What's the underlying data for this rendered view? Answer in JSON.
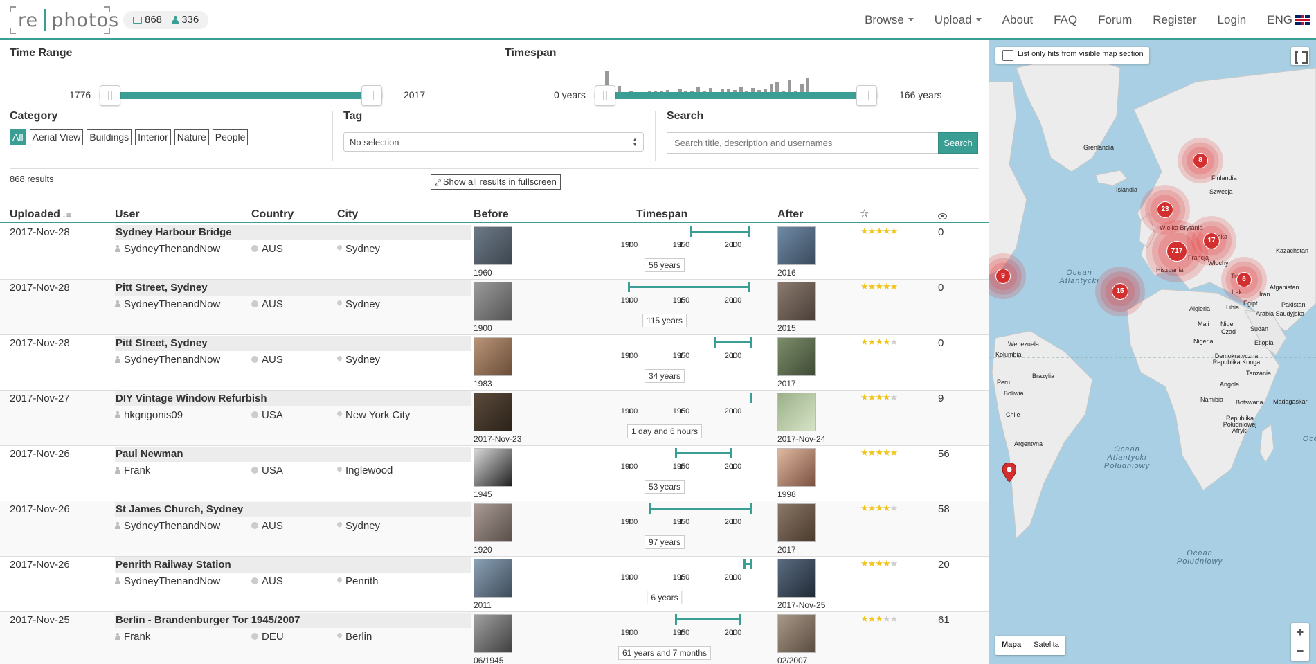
{
  "header": {
    "photo_count": "868",
    "user_count": "336",
    "nav": {
      "browse": "Browse",
      "upload": "Upload",
      "about": "About",
      "faq": "FAQ",
      "forum": "Forum",
      "register": "Register",
      "login": "Login",
      "language": "ENG"
    }
  },
  "filters": {
    "time_range_title": "Time Range",
    "time_range_min": "1776",
    "time_range_max": "2017",
    "timespan_title": "Timespan",
    "timespan_min": "0 years",
    "timespan_max": "166 years",
    "category_title": "Category",
    "categories": [
      "All",
      "Aerial View",
      "Buildings",
      "Interior",
      "Nature",
      "People"
    ],
    "active_category": "All",
    "tag_title": "Tag",
    "tag_value": "No selection",
    "search_title": "Search",
    "search_placeholder": "Search title, description and usernames",
    "search_button": "Search"
  },
  "results": {
    "count_text": "868 results",
    "fullscreen_label": "Show all results in fullscreen"
  },
  "table": {
    "headers": {
      "uploaded": "Uploaded",
      "user": "User",
      "country": "Country",
      "city": "City",
      "before": "Before",
      "timespan": "Timespan",
      "after": "After",
      "rating_icon": "star-icon",
      "views_icon": "eye-icon"
    },
    "timeline_ticks": [
      "1900",
      "1950",
      "2000"
    ],
    "rows": [
      {
        "uploaded": "2017-Nov-28",
        "title": "Sydney Harbour Bridge",
        "user": "SydneyThenandNow",
        "country": "AUS",
        "city": "Sydney",
        "before_date": "1960",
        "after_date": "2016",
        "before_year": 1960,
        "after_year": 2016,
        "span": "56 years",
        "rating": 5,
        "views": "0"
      },
      {
        "uploaded": "2017-Nov-28",
        "title": "Pitt Street, Sydney",
        "user": "SydneyThenandNow",
        "country": "AUS",
        "city": "Sydney",
        "before_date": "1900",
        "after_date": "2015",
        "before_year": 1900,
        "after_year": 2015,
        "span": "115 years",
        "rating": 5,
        "views": "0"
      },
      {
        "uploaded": "2017-Nov-28",
        "title": "Pitt Street, Sydney",
        "user": "SydneyThenandNow",
        "country": "AUS",
        "city": "Sydney",
        "before_date": "1983",
        "after_date": "2017",
        "before_year": 1983,
        "after_year": 2017,
        "span": "34 years",
        "rating": 4,
        "views": "0"
      },
      {
        "uploaded": "2017-Nov-27",
        "title": "DIY Vintage Window Refurbish",
        "user": "hkgrigonis09",
        "country": "USA",
        "city": "New York City",
        "before_date": "2017-Nov-23",
        "after_date": "2017-Nov-24",
        "before_year": 2017,
        "after_year": 2017,
        "span": "1 day and 6 hours",
        "rating": 4,
        "views": "9"
      },
      {
        "uploaded": "2017-Nov-26",
        "title": "Paul Newman",
        "user": "Frank",
        "country": "USA",
        "city": "Inglewood",
        "before_date": "1945",
        "after_date": "1998",
        "before_year": 1945,
        "after_year": 1998,
        "span": "53 years",
        "rating": 5,
        "views": "56"
      },
      {
        "uploaded": "2017-Nov-26",
        "title": "St James Church, Sydney",
        "user": "SydneyThenandNow",
        "country": "AUS",
        "city": "Sydney",
        "before_date": "1920",
        "after_date": "2017",
        "before_year": 1920,
        "after_year": 2017,
        "span": "97 years",
        "rating": 4,
        "views": "58"
      },
      {
        "uploaded": "2017-Nov-26",
        "title": "Penrith Railway Station",
        "user": "SydneyThenandNow",
        "country": "AUS",
        "city": "Penrith",
        "before_date": "2011",
        "after_date": "2017-Nov-25",
        "before_year": 2011,
        "after_year": 2017,
        "span": "6 years",
        "rating": 4,
        "views": "20"
      },
      {
        "uploaded": "2017-Nov-25",
        "title": "Berlin - Brandenburger Tor 1945/2007",
        "user": "Frank",
        "country": "DEU",
        "city": "Berlin",
        "before_date": "06/1945",
        "after_date": "02/2007",
        "before_year": 1945,
        "after_year": 2007,
        "span": "61 years and 7 months",
        "rating": 3,
        "views": "61"
      }
    ]
  },
  "map": {
    "visible_toggle_label": "List only hits from visible map section",
    "type_map": "Mapa",
    "type_satellite": "Satelita",
    "zoom_in": "+",
    "zoom_out": "−",
    "clusters": [
      "8",
      "23",
      "717",
      "17",
      "6",
      "9",
      "15"
    ],
    "labels": [
      "Grenlandia",
      "Finlandia",
      "Szwecja",
      "Islandia",
      "Wielka Brytania",
      "Polska",
      "Francja",
      "Włochy",
      "Hiszpania",
      "Kazachstan",
      "Turcja",
      "Irak",
      "Iran",
      "Afganistan",
      "Pakistan",
      "Egipt",
      "Libia",
      "Algieria",
      "Arabia Saudyjska",
      "Mali",
      "Niger",
      "Czad",
      "Sudan",
      "Nigeria",
      "Etiopia",
      "Wenezuela",
      "Kolumbia",
      "Demokratyczna Republika Konga",
      "Tanzania",
      "Angola",
      "Peru",
      "Brazylia",
      "Boliwia",
      "Namibia",
      "Botswana",
      "Madagaskar",
      "Chile",
      "Republika Południowej Afryki",
      "Argentyna"
    ],
    "oceans": [
      "Ocean Atlantycki",
      "Ocean Atlantycki Południowy",
      "Ocean Południowy",
      "Ocea Indyj"
    ]
  }
}
